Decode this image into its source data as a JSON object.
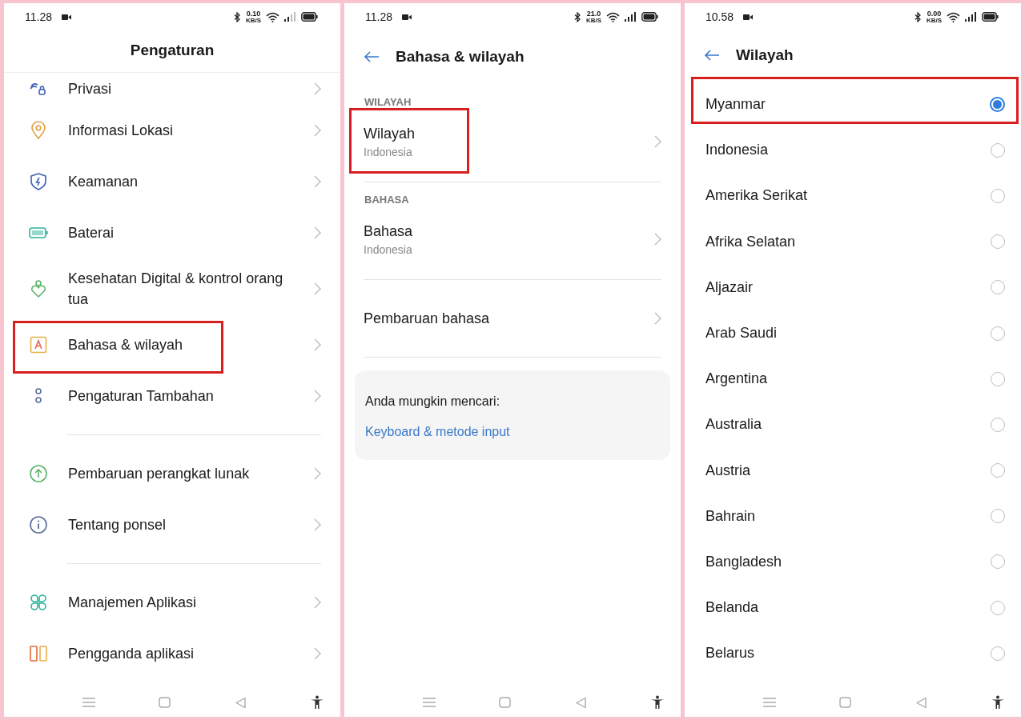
{
  "settings_screen": {
    "status_bar": {
      "time": "11.28",
      "speed": "0.10",
      "speed_unit": "KB/S"
    },
    "title": "Pengaturan",
    "groups": [
      {
        "items": [
          {
            "label": "Privasi",
            "highlighted": false
          },
          {
            "label": "Informasi Lokasi",
            "highlighted": false
          },
          {
            "label": "Keamanan",
            "highlighted": false
          },
          {
            "label": "Baterai",
            "highlighted": false
          },
          {
            "label": "Kesehatan Digital & kontrol orang tua",
            "highlighted": false
          },
          {
            "label": "Bahasa & wilayah",
            "highlighted": true
          },
          {
            "label": "Pengaturan Tambahan",
            "highlighted": false
          }
        ]
      },
      {
        "items": [
          {
            "label": "Pembaruan perangkat lunak",
            "highlighted": false
          },
          {
            "label": "Tentang ponsel",
            "highlighted": false
          }
        ]
      },
      {
        "items": [
          {
            "label": "Manajemen Aplikasi",
            "highlighted": false
          },
          {
            "label": "Pengganda aplikasi",
            "highlighted": false
          }
        ]
      }
    ]
  },
  "language_region_screen": {
    "status_bar": {
      "time": "11.28",
      "speed": "21.0",
      "speed_unit": "KB/S"
    },
    "title": "Bahasa & wilayah",
    "sections": [
      {
        "heading": "WILAYAH",
        "items": [
          {
            "label": "Wilayah",
            "value": "Indonesia",
            "highlighted": true
          }
        ]
      },
      {
        "heading": "BAHASA",
        "items": [
          {
            "label": "Bahasa",
            "value": "Indonesia",
            "highlighted": false
          }
        ]
      },
      {
        "items": [
          {
            "label": "Pembaruan bahasa",
            "highlighted": false
          }
        ]
      }
    ],
    "suggestion": {
      "prompt": "Anda mungkin mencari:",
      "link": "Keyboard & metode input"
    }
  },
  "region_screen": {
    "status_bar": {
      "time": "10.58",
      "speed": "0.00",
      "speed_unit": "KB/S"
    },
    "title": "Wilayah",
    "options": [
      {
        "label": "Myanmar",
        "selected": true,
        "highlighted": true
      },
      {
        "label": "Indonesia",
        "selected": false,
        "highlighted": false
      },
      {
        "label": "Amerika Serikat",
        "selected": false,
        "highlighted": false
      },
      {
        "label": "Afrika Selatan",
        "selected": false,
        "highlighted": false
      },
      {
        "label": "Aljazair",
        "selected": false,
        "highlighted": false
      },
      {
        "label": "Arab Saudi",
        "selected": false,
        "highlighted": false
      },
      {
        "label": "Argentina",
        "selected": false,
        "highlighted": false
      },
      {
        "label": "Australia",
        "selected": false,
        "highlighted": false
      },
      {
        "label": "Austria",
        "selected": false,
        "highlighted": false
      },
      {
        "label": "Bahrain",
        "selected": false,
        "highlighted": false
      },
      {
        "label": "Bangladesh",
        "selected": false,
        "highlighted": false
      },
      {
        "label": "Belanda",
        "selected": false,
        "highlighted": false
      },
      {
        "label": "Belarus",
        "selected": false,
        "highlighted": false
      }
    ]
  }
}
